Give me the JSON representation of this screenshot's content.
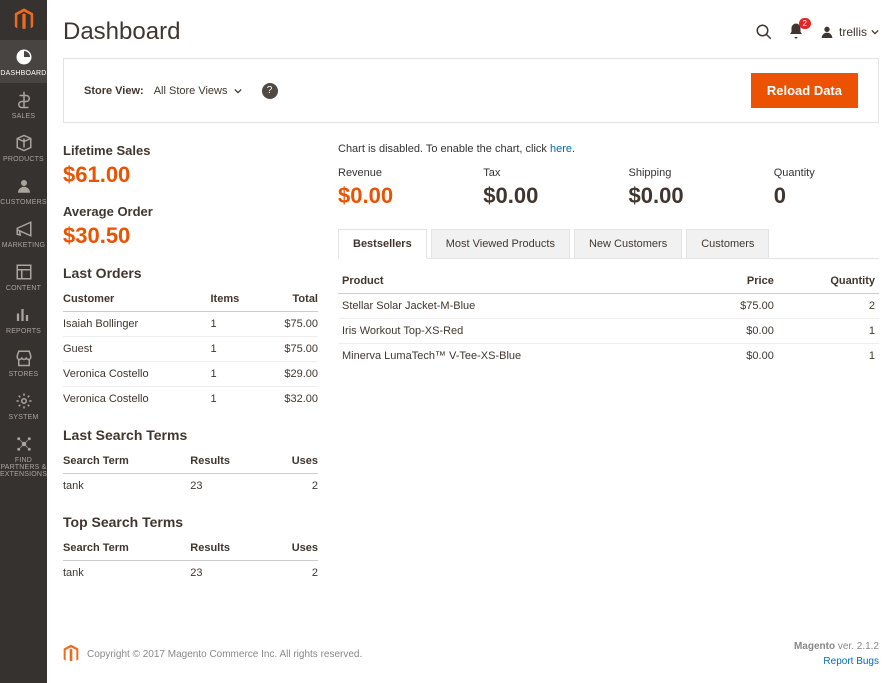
{
  "header": {
    "title": "Dashboard",
    "notif_count": "2",
    "username": "trellis"
  },
  "toolbar": {
    "store_view_label": "Store View:",
    "store_view_value": "All Store Views",
    "reload_label": "Reload Data"
  },
  "sidebar": {
    "items": [
      {
        "label": "DASHBOARD"
      },
      {
        "label": "SALES"
      },
      {
        "label": "PRODUCTS"
      },
      {
        "label": "CUSTOMERS"
      },
      {
        "label": "MARKETING"
      },
      {
        "label": "CONTENT"
      },
      {
        "label": "REPORTS"
      },
      {
        "label": "STORES"
      },
      {
        "label": "SYSTEM"
      },
      {
        "label": "FIND PARTNERS & EXTENSIONS"
      }
    ]
  },
  "metrics": {
    "lifetime_label": "Lifetime Sales",
    "lifetime_value": "$61.00",
    "avg_label": "Average Order",
    "avg_value": "$30.50"
  },
  "last_orders": {
    "title": "Last Orders",
    "cols": {
      "c0": "Customer",
      "c1": "Items",
      "c2": "Total"
    },
    "rows": [
      {
        "customer": "Isaiah Bollinger",
        "items": "1",
        "total": "$75.00"
      },
      {
        "customer": "Guest",
        "items": "1",
        "total": "$75.00"
      },
      {
        "customer": "Veronica Costello",
        "items": "1",
        "total": "$29.00"
      },
      {
        "customer": "Veronica Costello",
        "items": "1",
        "total": "$32.00"
      }
    ]
  },
  "last_search": {
    "title": "Last Search Terms",
    "cols": {
      "c0": "Search Term",
      "c1": "Results",
      "c2": "Uses"
    },
    "rows": [
      {
        "term": "tank",
        "results": "23",
        "uses": "2"
      }
    ]
  },
  "top_search": {
    "title": "Top Search Terms",
    "cols": {
      "c0": "Search Term",
      "c1": "Results",
      "c2": "Uses"
    },
    "rows": [
      {
        "term": "tank",
        "results": "23",
        "uses": "2"
      }
    ]
  },
  "chart_msg": {
    "pre": "Chart is disabled. To enable the chart, click ",
    "link": "here",
    "post": "."
  },
  "kpis": {
    "revenue": {
      "label": "Revenue",
      "value": "$0.00"
    },
    "tax": {
      "label": "Tax",
      "value": "$0.00"
    },
    "shipping": {
      "label": "Shipping",
      "value": "$0.00"
    },
    "quantity": {
      "label": "Quantity",
      "value": "0"
    }
  },
  "tabs": {
    "t0": "Bestsellers",
    "t1": "Most Viewed Products",
    "t2": "New Customers",
    "t3": "Customers"
  },
  "bestsellers": {
    "cols": {
      "c0": "Product",
      "c1": "Price",
      "c2": "Quantity"
    },
    "rows": [
      {
        "product": "Stellar Solar Jacket-M-Blue",
        "price": "$75.00",
        "qty": "2"
      },
      {
        "product": "Iris Workout Top-XS-Red",
        "price": "$0.00",
        "qty": "1"
      },
      {
        "product": "Minerva LumaTech™ V-Tee-XS-Blue",
        "price": "$0.00",
        "qty": "1"
      }
    ]
  },
  "footer": {
    "copyright": "Copyright © 2017 Magento Commerce Inc. All rights reserved.",
    "version_pre": "Magento",
    "version": " ver. 2.1.2",
    "report": "Report Bugs"
  }
}
